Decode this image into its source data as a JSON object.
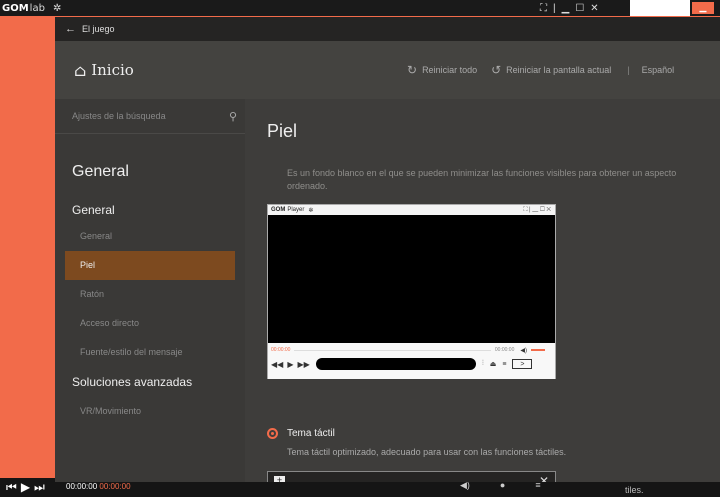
{
  "host": {
    "logo_main": "GOM",
    "logo_sub": "lab",
    "time_current": "00:00:00",
    "time_duration": "00:00:00",
    "tiles_text": "tiles."
  },
  "settings": {
    "topbar_title": "El juego",
    "home_label": "Inicio",
    "reset_all": "Reiniciar todo",
    "reset_screen": "Reiniciar la pantalla actual",
    "separator": "|",
    "language": "Español"
  },
  "sidebar": {
    "search_placeholder": "Ajustes de la búsqueda",
    "title": "General",
    "section1": "General",
    "items": [
      {
        "label": "General"
      },
      {
        "label": "Piel"
      },
      {
        "label": "Ratón"
      },
      {
        "label": "Acceso directo"
      },
      {
        "label": "Fuente/estilo del mensaje"
      }
    ],
    "section2": "Soluciones avanzadas",
    "items2": [
      {
        "label": "VR/Movimiento"
      }
    ]
  },
  "main": {
    "title": "Piel",
    "description": "Es un fondo blanco en el que se pueden minimizar las funciones visibles para obtener un aspecto ordenado.",
    "preview": {
      "title_bold": "GOM",
      "title_rest": "Player",
      "time_left": "00:00:00",
      "time_right": "00:00:00"
    },
    "option": {
      "label": "Tema táctil",
      "description": "Tema táctil optimizado, adecuado para usar con las funciones táctiles."
    }
  },
  "colors": {
    "accent": "#f26b4a",
    "active_item": "#7d4a1f",
    "panel": "#3e3d3b"
  }
}
